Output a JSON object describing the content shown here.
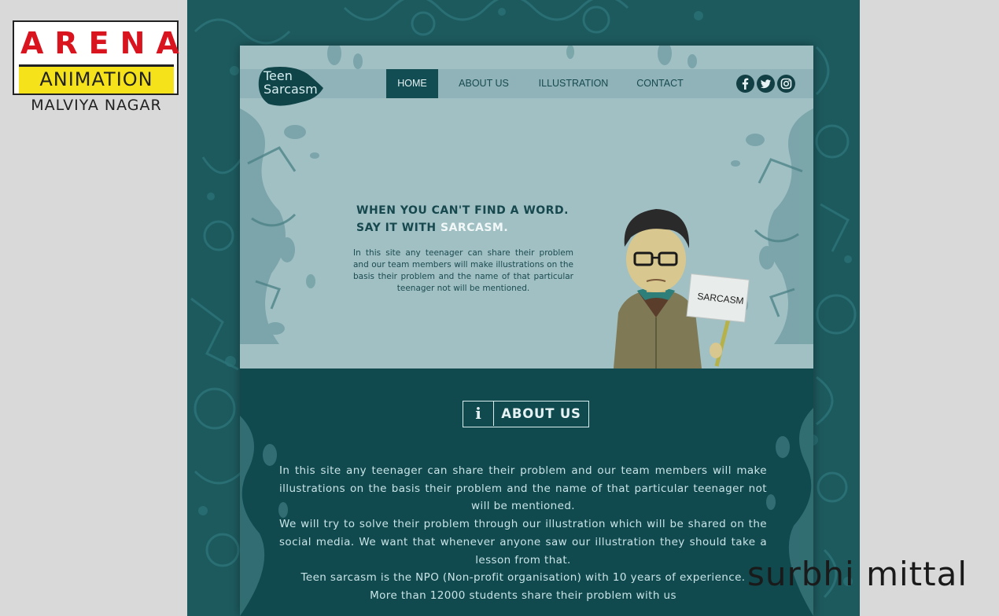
{
  "logo": {
    "top": "ARENA",
    "middle": "ANIMATION",
    "bottom": "MALVIYA NAGAR",
    "colors": {
      "red": "#d9141f",
      "yellow": "#f5e21a"
    }
  },
  "site": {
    "brand_line1": "Teen",
    "brand_line2": "Sarcasm",
    "nav": {
      "home": "HOME",
      "about": "ABOUT US",
      "illustration": "ILLUSTRATION",
      "contact": "CONTACT"
    },
    "social_icons": [
      "facebook-icon",
      "twitter-icon",
      "instagram-icon"
    ],
    "hero": {
      "tagline_line1": "WHEN YOU CAN'T FIND A WORD.",
      "tagline_line2_prefix": "SAY IT WITH ",
      "tagline_highlight": "SARCASM.",
      "description": "In this site any teenager can share their problem and our team members will make illustrations on the basis their problem and the name of that particular teenager not will be mentioned.",
      "sign_text": "SARCASM"
    },
    "about": {
      "icon_glyph": "i",
      "title": "ABOUT US",
      "paragraphs": [
        "In this site any teenager can share their problem and our team members will make illustrations on the basis their problem and the name of that particular teenager not will be mentioned.",
        "We will try to solve their problem through our illustration which will be shared on the social media. We want that whenever anyone saw our illustration they should take a lesson from that.",
        "Teen sarcasm is the NPO (Non-profit organisation) with 10 years of experience.",
        "More than 12000 students share their problem with us"
      ]
    },
    "colors": {
      "dark_teal": "#104a4f",
      "border_teal": "#1d5a5e",
      "hero_bg": "#a0c0c4",
      "nav_active": "#114d52"
    }
  },
  "watermark": "surbhi mittal"
}
